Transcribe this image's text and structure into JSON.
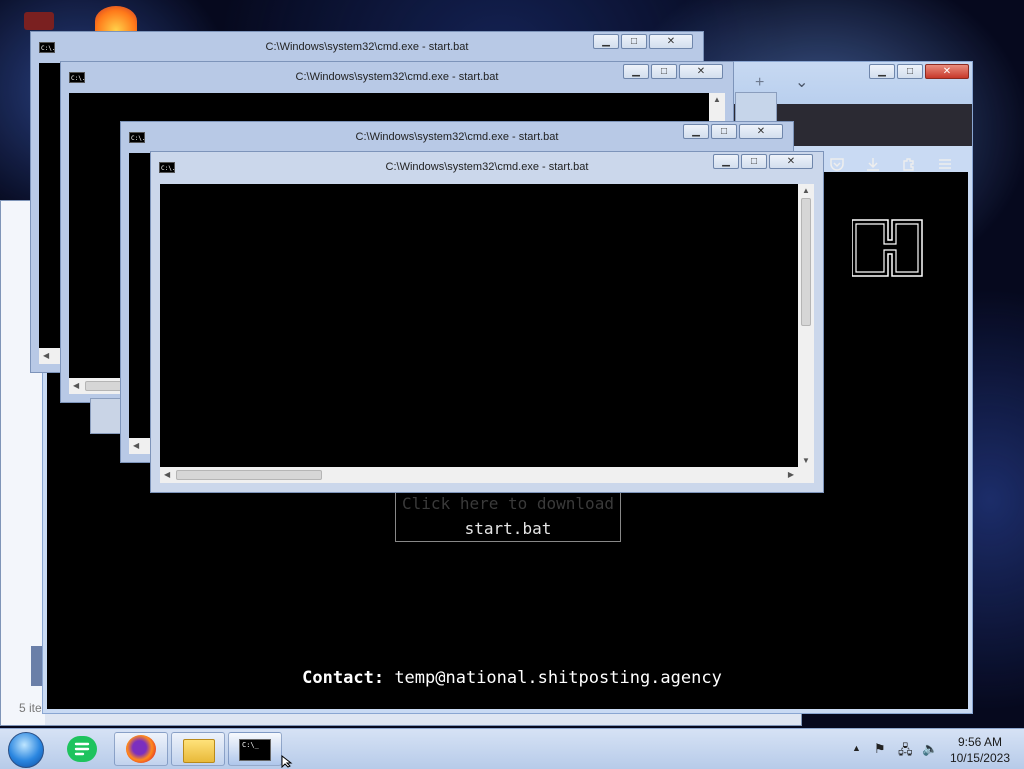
{
  "window_title": "C:\\Windows\\system32\\cmd.exe - start.bat",
  "cmd_windows": [
    {
      "title": "C:\\Windows\\system32\\cmd.exe - start.bat"
    },
    {
      "title": "C:\\Windows\\system32\\cmd.exe - start.bat"
    },
    {
      "title": "C:\\Windows\\system32\\cmd.exe - start.bat"
    },
    {
      "title": "C:\\Windows\\system32\\cmd.exe - start.bat"
    }
  ],
  "cmd_icon_text": "C:\\.",
  "browser": {
    "page": {
      "download_line1": "Click here to download",
      "download_line2": "start.bat",
      "contact_label": "Contact:",
      "contact_email": "temp@national.shitposting.agency"
    },
    "toolbar_icons": [
      "pocket-icon",
      "download-icon",
      "extensions-icon",
      "menu-icon"
    ]
  },
  "explorer": {
    "status_text": "5 ite"
  },
  "taskbar": {
    "pinned": [
      "start-orb",
      "notes-app",
      "firefox",
      "file-explorer",
      "cmd"
    ],
    "cmd_button_text": "C:\\_",
    "time": "9:56 AM",
    "date": "10/15/2023"
  },
  "colors": {
    "accent": "#b8c9e6",
    "close": "#c7382a",
    "terminal_bg": "#000000"
  }
}
